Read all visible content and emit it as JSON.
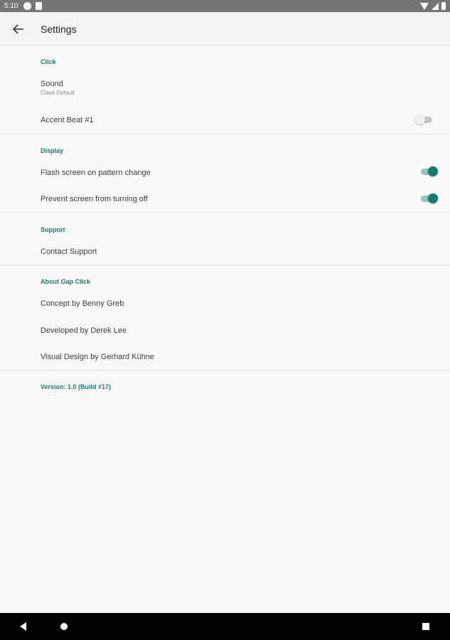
{
  "status_bar": {
    "time": "5:10"
  },
  "app_bar": {
    "title": "Settings"
  },
  "sections": [
    {
      "header": "Click",
      "items": [
        {
          "label": "Sound",
          "summary": "Clave Default"
        },
        {
          "label": "Accent Beat #1",
          "toggle": "off"
        }
      ]
    },
    {
      "header": "Display",
      "items": [
        {
          "label": "Flash screen on pattern change",
          "toggle": "on"
        },
        {
          "label": "Prevent screen from turning off",
          "toggle": "on"
        }
      ]
    },
    {
      "header": "Support",
      "items": [
        {
          "label": "Contact Support"
        }
      ]
    },
    {
      "header": "About Gap Click",
      "items": [
        {
          "label": "Concept by Benny Greb"
        },
        {
          "label": "Developed by Derek Lee"
        },
        {
          "label": "Visual Design by Gerhard Kühne"
        }
      ]
    }
  ],
  "version": "Version: 1.0 (Build #17)",
  "colors": {
    "accent": "#1b7a6e",
    "toggle_on": "#117d70",
    "background": "#fafafa"
  }
}
